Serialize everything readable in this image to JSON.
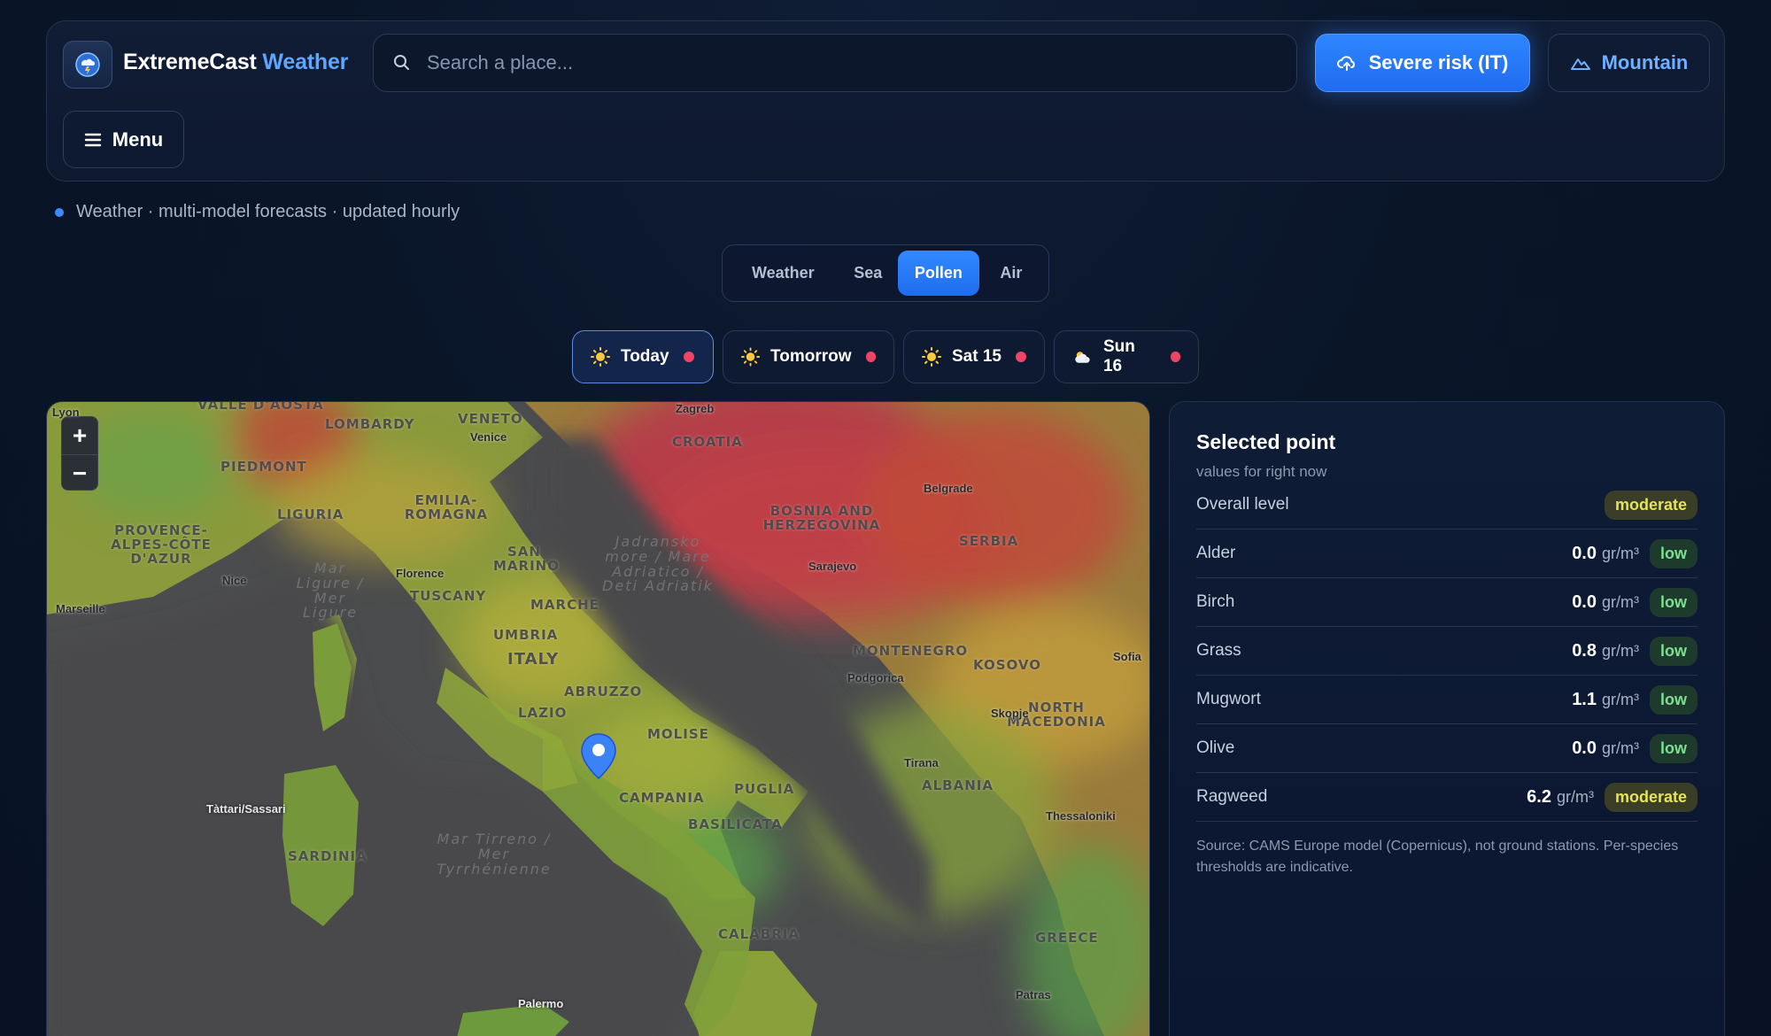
{
  "brand": {
    "name": "ExtremeCast",
    "accent": "Weather"
  },
  "search": {
    "placeholder": "Search a place..."
  },
  "buttons": {
    "severe": "Severe risk (IT)",
    "mountain": "Mountain",
    "menu": "Menu"
  },
  "status": "Weather · multi-model forecasts · updated hourly",
  "modes": [
    {
      "label": "Weather",
      "active": false
    },
    {
      "label": "Sea",
      "active": false
    },
    {
      "label": "Pollen",
      "active": true
    },
    {
      "label": "Air",
      "active": false
    }
  ],
  "days": [
    {
      "label": "Today",
      "icon": "sun-icon",
      "active": true
    },
    {
      "label": "Tomorrow",
      "icon": "sun-icon",
      "active": false
    },
    {
      "label": "Sat 15",
      "icon": "sun-icon",
      "active": false
    },
    {
      "label": "Sun 16",
      "icon": "cloud-sun-icon",
      "active": false
    }
  ],
  "map": {
    "regions": [
      "VALLE D'AOSTA",
      "LOMBARDY",
      "VENETO",
      "PIEDMONT",
      "LIGURIA",
      "EMILIA-ROMAGNA",
      "PROVENCE-ALPES-CÔTE D'AZUR",
      "SAN MARINO",
      "TUSCANY",
      "MARCHE",
      "UMBRIA",
      "ITALY",
      "ABRUZZO",
      "LAZIO",
      "MOLISE",
      "CAMPANIA",
      "PUGLIA",
      "BASILICATA",
      "CALABRIA",
      "SARDINIA",
      "CROATIA",
      "BOSNIA AND HERZEGOVINA",
      "SERBIA",
      "MONTENEGRO",
      "KOSOVO",
      "NORTH MACEDONIA",
      "ALBANIA",
      "GREECE"
    ],
    "cities": [
      "Lyon",
      "Venice",
      "Zagreb",
      "Belgrade",
      "Nice",
      "Florence",
      "Marseille",
      "Sarajevo",
      "Sofia",
      "Podgorica",
      "Skopje",
      "Tirana",
      "Tàttari/Sassari",
      "Thessaloniki",
      "Patras",
      "Palermo"
    ],
    "seas": [
      "Mar Ligure / Mer Ligure",
      "Jadransko more / Mare Adriatico / Deti Adriatik",
      "Mar Tirreno / Mer Tyrrhénienne"
    ],
    "zoom_in": "+",
    "zoom_out": "−"
  },
  "panel": {
    "title": "Selected point",
    "subtitle": "values for right now",
    "overall": {
      "label": "Overall level",
      "level": "moderate"
    },
    "species": [
      {
        "name": "Alder",
        "value": "0.0",
        "unit": "gr/m³",
        "level": "low"
      },
      {
        "name": "Birch",
        "value": "0.0",
        "unit": "gr/m³",
        "level": "low"
      },
      {
        "name": "Grass",
        "value": "0.8",
        "unit": "gr/m³",
        "level": "low"
      },
      {
        "name": "Mugwort",
        "value": "1.1",
        "unit": "gr/m³",
        "level": "low"
      },
      {
        "name": "Olive",
        "value": "0.0",
        "unit": "gr/m³",
        "level": "low"
      },
      {
        "name": "Ragweed",
        "value": "6.2",
        "unit": "gr/m³",
        "level": "moderate"
      }
    ],
    "note": "Source: CAMS Europe model (Copernicus), not ground stations. Per-species thresholds are indicative."
  },
  "colors": {
    "accent": "#2f86ff",
    "low": "#7be08f",
    "moderate": "#e6e35a",
    "alert_dot": "#ef4565"
  }
}
